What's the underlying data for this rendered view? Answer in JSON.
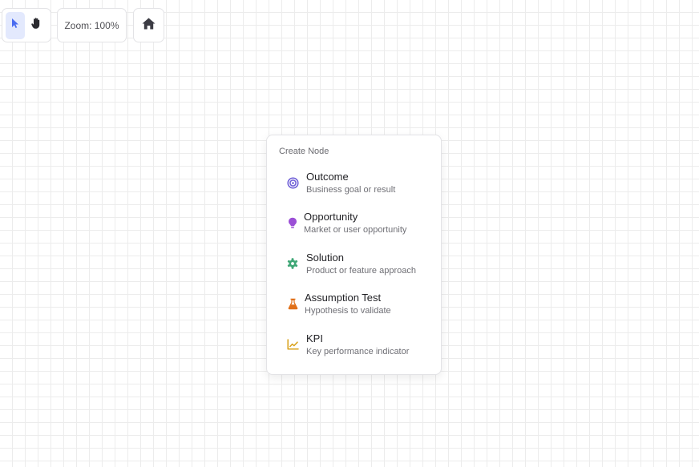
{
  "toolbar": {
    "zoom_label": "Zoom: 100%",
    "tools": [
      {
        "name": "select",
        "icon": "cursor-icon",
        "active": true
      },
      {
        "name": "pan",
        "icon": "hand-icon",
        "active": false
      }
    ],
    "home_icon": "home-icon"
  },
  "menu": {
    "heading": "Create Node",
    "items": [
      {
        "title": "Outcome",
        "description": "Business goal or result",
        "icon": "target-icon",
        "color": "#6b5bd6"
      },
      {
        "title": "Opportunity",
        "description": "Market or user opportunity",
        "icon": "lightbulb-icon",
        "color": "#9b4fd6"
      },
      {
        "title": "Solution",
        "description": "Product or feature approach",
        "icon": "gear-icon",
        "color": "#3fa776"
      },
      {
        "title": "Assumption Test",
        "description": "Hypothesis to validate",
        "icon": "flask-icon",
        "color": "#e0701a"
      },
      {
        "title": "KPI",
        "description": "Key performance indicator",
        "icon": "chart-line-icon",
        "color": "#d9a21b"
      }
    ]
  },
  "colors": {
    "accent": "#4a6cf0",
    "active_tool_bg": "#e3e9fd",
    "grid": "#ececec"
  }
}
